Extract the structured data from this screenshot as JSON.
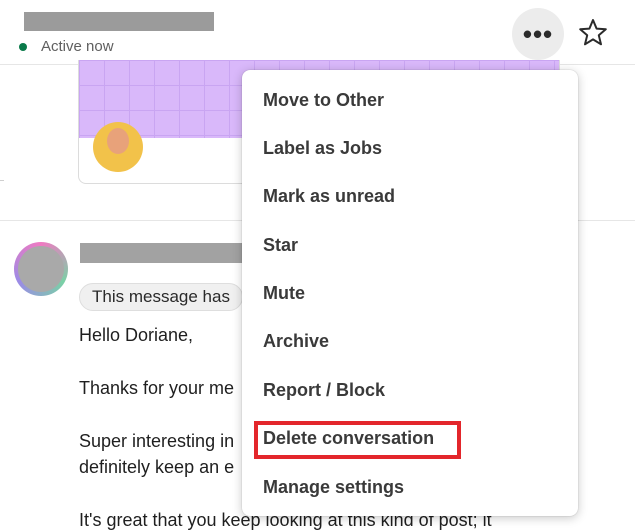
{
  "header": {
    "status_label": "Active now",
    "status_color": "#0a7a4a",
    "more_glyph": "•••",
    "more_icon": "ellipsis-icon",
    "star_icon": "star-outline-icon"
  },
  "message": {
    "badge_text": "This message has",
    "lines": [
      "Hello Doriane,",
      "Thanks for your me",
      "Super interesting in",
      "definitely keep an e",
      "It's great that you keep looking at this kind of post; it"
    ]
  },
  "menu": {
    "items": [
      "Move to Other",
      "Label as Jobs",
      "Mark as unread",
      "Star",
      "Mute",
      "Archive",
      "Report / Block",
      "Delete conversation",
      "Manage settings"
    ]
  },
  "highlight_color": "#e3262b"
}
